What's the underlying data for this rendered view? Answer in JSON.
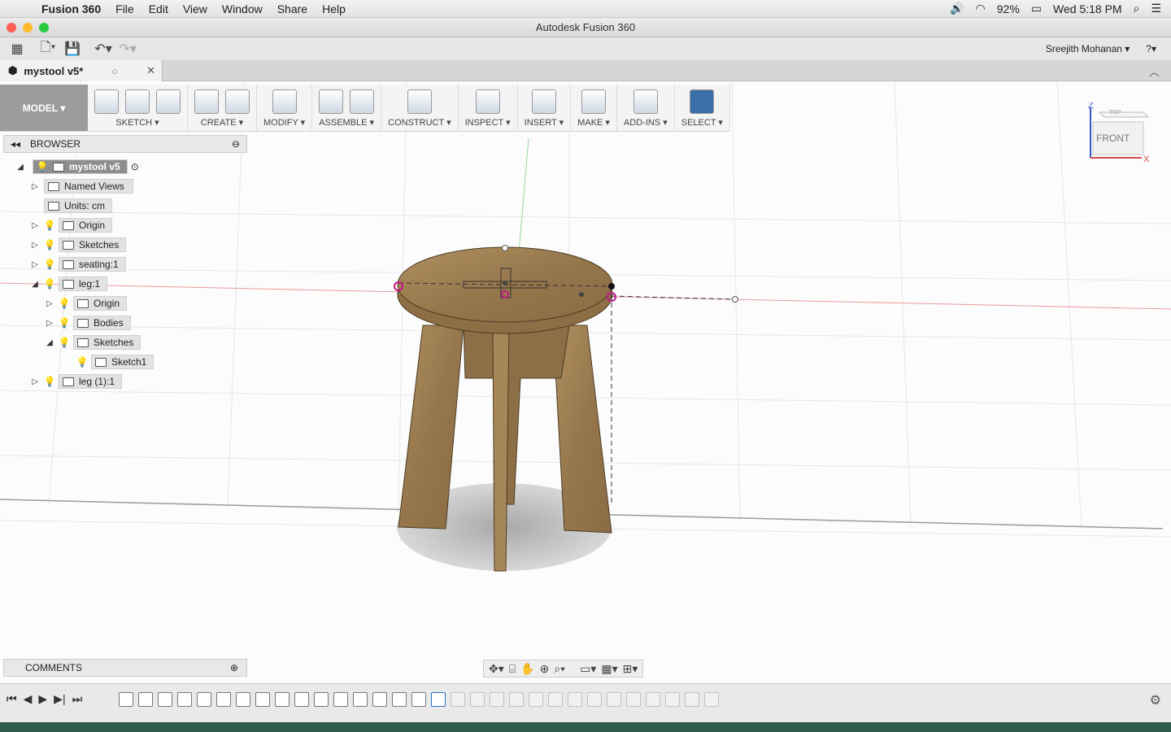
{
  "menubar": {
    "app": "Fusion 360",
    "items": [
      "File",
      "Edit",
      "View",
      "Window",
      "Share",
      "Help"
    ],
    "battery": "92%",
    "clock": "Wed 5:18 PM"
  },
  "window": {
    "title": "Autodesk Fusion 360"
  },
  "qat": {
    "user": "Sreejith Mohanan ▾",
    "help": "?▾"
  },
  "tab": {
    "name": "mystool v5*"
  },
  "toolbar": {
    "model": "MODEL ▾",
    "groups": [
      "SKETCH ▾",
      "CREATE ▾",
      "MODIFY ▾",
      "ASSEMBLE ▾",
      "CONSTRUCT ▾",
      "INSPECT ▾",
      "INSERT ▾",
      "MAKE ▾",
      "ADD-INS ▾",
      "SELECT ▾"
    ]
  },
  "browser": {
    "title": "BROWSER",
    "items": [
      {
        "label": "mystool v5"
      },
      {
        "label": "Named Views"
      },
      {
        "label": "Units: cm"
      },
      {
        "label": "Origin"
      },
      {
        "label": "Sketches"
      },
      {
        "label": "seating:1"
      },
      {
        "label": "leg:1"
      },
      {
        "label": "Origin"
      },
      {
        "label": "Bodies"
      },
      {
        "label": "Sketches"
      },
      {
        "label": "Sketch1"
      },
      {
        "label": "leg (1):1"
      }
    ]
  },
  "viewcube": {
    "top": "TOP",
    "front": "FRONT",
    "axis_z": "Z",
    "axis_x": "X"
  },
  "comments": {
    "title": "COMMENTS"
  }
}
